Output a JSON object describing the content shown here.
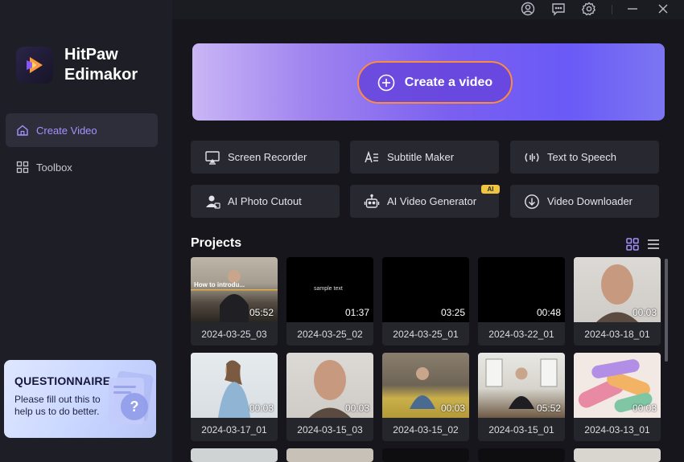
{
  "app": {
    "name_line1": "HitPaw",
    "name_line2": "Edimakor"
  },
  "titlebar": {
    "icons": [
      "account-icon",
      "feedback-icon",
      "settings-icon",
      "minimize-icon",
      "close-icon"
    ]
  },
  "sidebar": {
    "items": [
      {
        "label": "Create Video",
        "icon": "home-icon",
        "active": true
      },
      {
        "label": "Toolbox",
        "icon": "grid-icon",
        "active": false
      }
    ],
    "questionnaire": {
      "title": "QUESTIONNAIRE",
      "text": "Please fill out this to help us to do better."
    }
  },
  "hero": {
    "create_label": "Create a video"
  },
  "tools": [
    {
      "label": "Screen Recorder",
      "icon": "screen-record-icon"
    },
    {
      "label": "Subtitle Maker",
      "icon": "subtitle-icon"
    },
    {
      "label": "Text to Speech",
      "icon": "text-to-speech-icon"
    },
    {
      "label": "AI Photo Cutout",
      "icon": "person-cutout-icon"
    },
    {
      "label": "AI Video Generator",
      "icon": "robot-icon",
      "badge": "AI"
    },
    {
      "label": "Video Downloader",
      "icon": "download-icon"
    }
  ],
  "projects": {
    "title": "Projects",
    "items": [
      {
        "name": "2024-03-25_03",
        "duration": "05:52",
        "overlay": "How to introdu..."
      },
      {
        "name": "2024-03-25_02",
        "duration": "01:37",
        "overlay": "sample text"
      },
      {
        "name": "2024-03-25_01",
        "duration": "03:25"
      },
      {
        "name": "2024-03-22_01",
        "duration": "00:48"
      },
      {
        "name": "2024-03-18_01",
        "duration": "00:03"
      },
      {
        "name": "2024-03-17_01",
        "duration": "00:03"
      },
      {
        "name": "2024-03-15_03",
        "duration": "00:03"
      },
      {
        "name": "2024-03-15_02",
        "duration": "00:03"
      },
      {
        "name": "2024-03-15_01",
        "duration": "05:52"
      },
      {
        "name": "2024-03-13_01",
        "duration": "00:03"
      }
    ]
  },
  "colors": {
    "accent": "#a591ff",
    "button_border": "#ff8c3a",
    "ai_badge": "#f0c640"
  }
}
